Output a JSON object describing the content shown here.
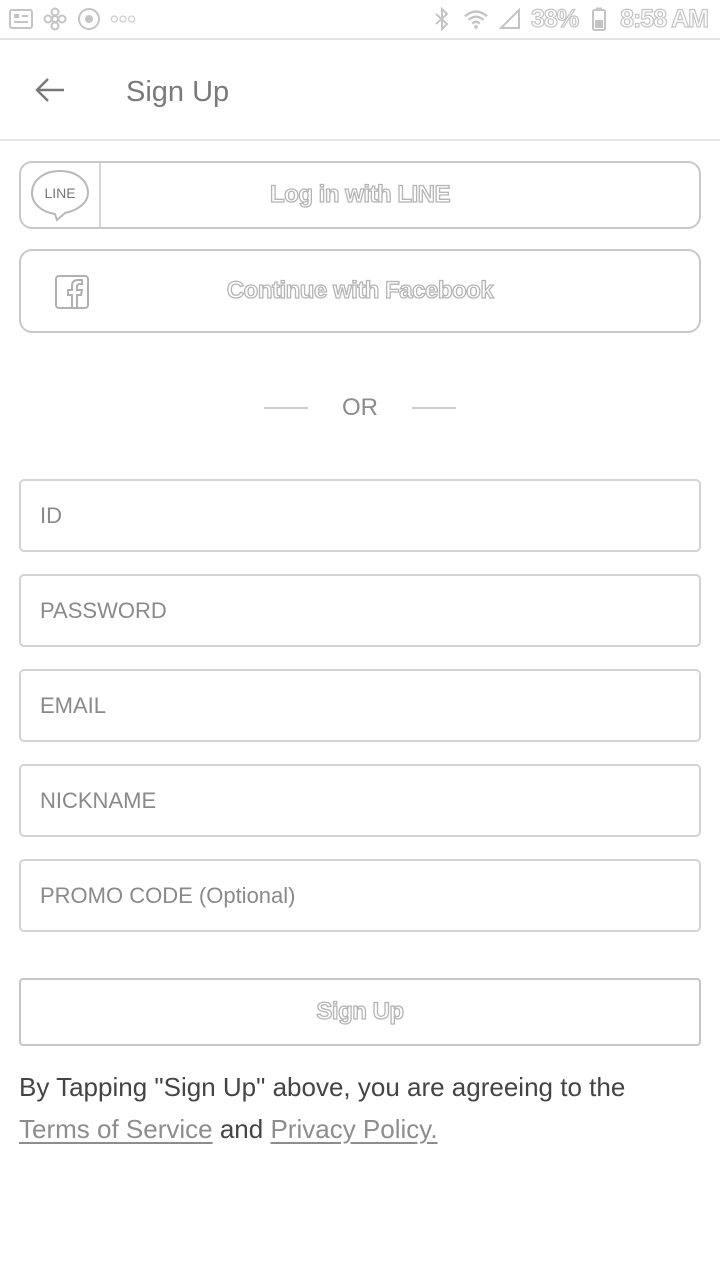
{
  "status_bar": {
    "battery": "38%",
    "time": "8:58 AM"
  },
  "app_bar": {
    "title": "Sign Up"
  },
  "social": {
    "line_logo_text": "LINE",
    "line_label": "Log in with LINE",
    "facebook_label": "Continue with Facebook"
  },
  "divider": {
    "label": "OR"
  },
  "form": {
    "id_placeholder": "ID",
    "password_placeholder": "PASSWORD",
    "email_placeholder": "EMAIL",
    "nickname_placeholder": "NICKNAME",
    "promo_placeholder": "PROMO CODE (Optional)",
    "submit_label": "Sign Up"
  },
  "agreement": {
    "prefix": "By Tapping \"Sign Up\" above, you are agreeing to the",
    "terms_link": "Terms of Service",
    "conjunction": "and",
    "privacy_link": "Privacy Policy."
  },
  "icons": {
    "back": "arrow-left-icon",
    "facebook": "facebook-icon",
    "line": "line-logo-icon"
  },
  "colors": {
    "border": "#c9c9c9",
    "muted_text": "#8a8a8a",
    "body_text": "#444444"
  }
}
